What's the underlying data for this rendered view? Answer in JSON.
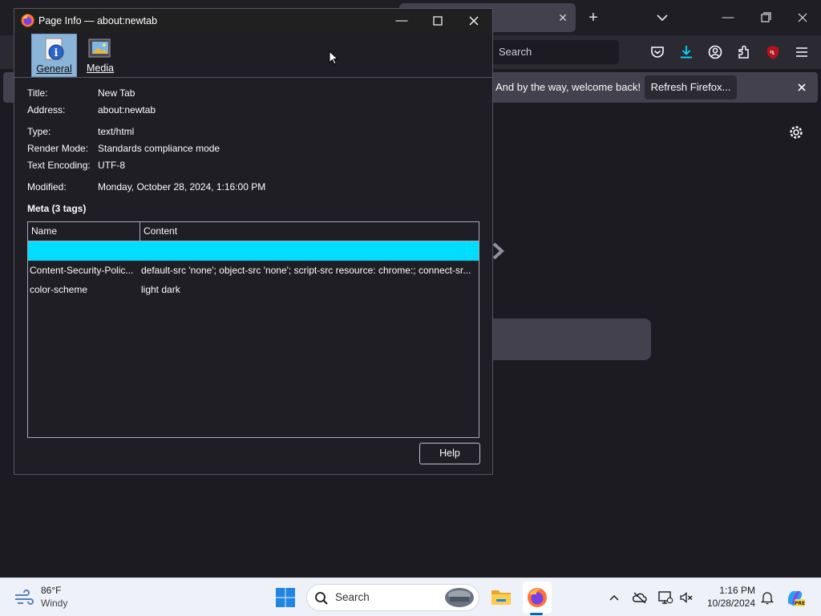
{
  "browser": {
    "tab_close": "✕",
    "new_tab": "+",
    "search_placeholder": "Search",
    "notification": {
      "text": "And by the way, welcome back!",
      "button": "Refresh Firefox..."
    }
  },
  "dialog": {
    "title": "Page Info — about:newtab",
    "tabs": [
      {
        "label": "General",
        "icon": "info-icon"
      },
      {
        "label": "Media",
        "icon": "media-icon"
      }
    ],
    "fields": {
      "title": {
        "label": "Title:",
        "value": "New Tab"
      },
      "address": {
        "label": "Address:",
        "value": "about:newtab"
      },
      "type": {
        "label": "Type:",
        "value": "text/html"
      },
      "render_mode": {
        "label": "Render Mode:",
        "value": "Standards compliance mode"
      },
      "encoding": {
        "label": "Text Encoding:",
        "value": "UTF-8"
      },
      "modified": {
        "label": "Modified:",
        "value": "Monday, October 28, 2024, 1:16:00 PM"
      }
    },
    "meta_header": "Meta (3 tags)",
    "meta_columns": [
      "Name",
      "Content"
    ],
    "meta_rows": [
      {
        "name": "",
        "content": ""
      },
      {
        "name": "Content-Security-Polic...",
        "content": "default-src 'none'; object-src 'none'; script-src resource: chrome:; connect-sr..."
      },
      {
        "name": "color-scheme",
        "content": "light dark"
      }
    ],
    "help_button": "Help"
  },
  "taskbar": {
    "weather_temp": "86°F",
    "weather_desc": "Windy",
    "search_label": "Search",
    "time": "1:16 PM",
    "date": "10/28/2024"
  },
  "colors": {
    "selection": "#00ddff",
    "dialog_bg": "#1f1e25",
    "taskbar_bg": "#eef1f7"
  }
}
